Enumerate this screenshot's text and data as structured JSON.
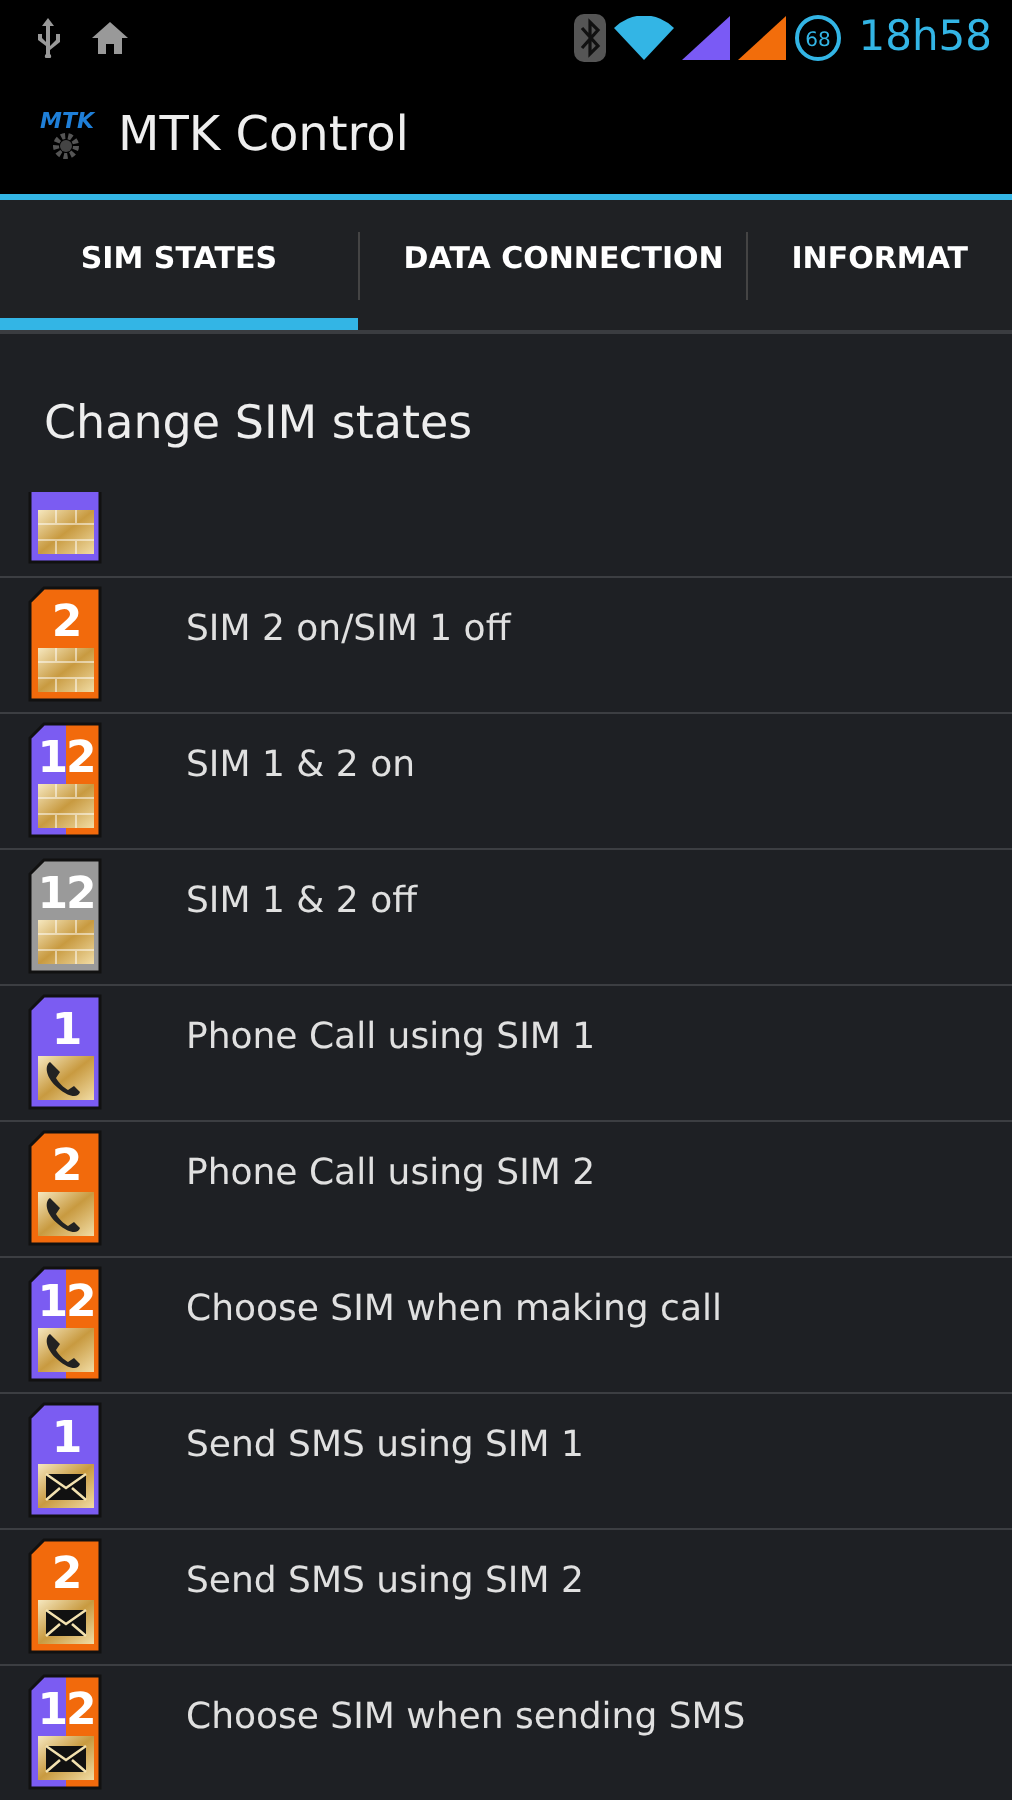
{
  "status_bar": {
    "battery": "68",
    "time": "18h58"
  },
  "app_bar": {
    "logo": "MTK",
    "title": "MTK Control"
  },
  "tabs": [
    {
      "label": "SIM STATES",
      "selected": true
    },
    {
      "label": "DATA CONNECTION",
      "selected": false
    },
    {
      "label": "INFORMAT",
      "selected": false
    }
  ],
  "heading": "Change SIM states",
  "items": [
    {
      "kind": "sim1_plain"
    },
    {
      "kind": "sim2_plain",
      "number": "2",
      "label": "SIM 2 on/SIM 1 off"
    },
    {
      "kind": "both_plain",
      "number": "12",
      "label": "SIM 1 & 2 on"
    },
    {
      "kind": "off_plain",
      "number": "12",
      "label": "SIM 1 & 2 off"
    },
    {
      "kind": "sim1_phone",
      "number": "1",
      "label": "Phone Call using SIM 1"
    },
    {
      "kind": "sim2_phone",
      "number": "2",
      "label": "Phone Call using SIM 2"
    },
    {
      "kind": "both_phone",
      "number": "12",
      "label": "Choose SIM when making call"
    },
    {
      "kind": "sim1_sms",
      "number": "1",
      "label": "Send SMS using SIM 1"
    },
    {
      "kind": "sim2_sms",
      "number": "2",
      "label": "Send SMS using SIM 2"
    },
    {
      "kind": "both_sms",
      "number": "12",
      "label": "Choose SIM when sending SMS"
    }
  ]
}
